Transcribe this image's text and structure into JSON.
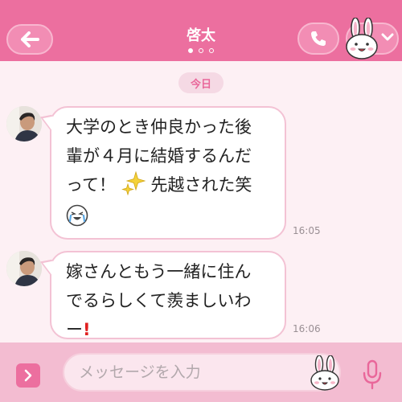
{
  "header": {
    "title": "啓太",
    "back_icon": "arrow-left-icon",
    "call_icon": "phone-icon",
    "menu_icon": "chevron-down-icon",
    "page_count": 3,
    "active_page": 1
  },
  "chat": {
    "date_label": "今日",
    "messages": [
      {
        "lines": [
          "大学のとき仲良かった後",
          "輩が４月に結婚するんだ",
          "って！"
        ],
        "line3_after_sparkle": "先越された笑",
        "emoji": [
          "sparkle-icon",
          "crying-laugh-sticker-icon"
        ],
        "time": "16:05"
      },
      {
        "lines": [
          "嫁さんともう一緒に住ん",
          "でるらしくて羨ましいわ",
          "ー"
        ],
        "emoji": [
          "red-exclamation-icon"
        ],
        "time": "16:06"
      }
    ]
  },
  "input": {
    "placeholder": "メッセージを入力",
    "value": ""
  },
  "colors": {
    "header_bg": "#ec6f9f",
    "chat_bg": "#fdf0f4",
    "bubble_border": "#f3c2d4",
    "input_bar_bg": "#f3bcd1",
    "accent": "#e9679a"
  }
}
